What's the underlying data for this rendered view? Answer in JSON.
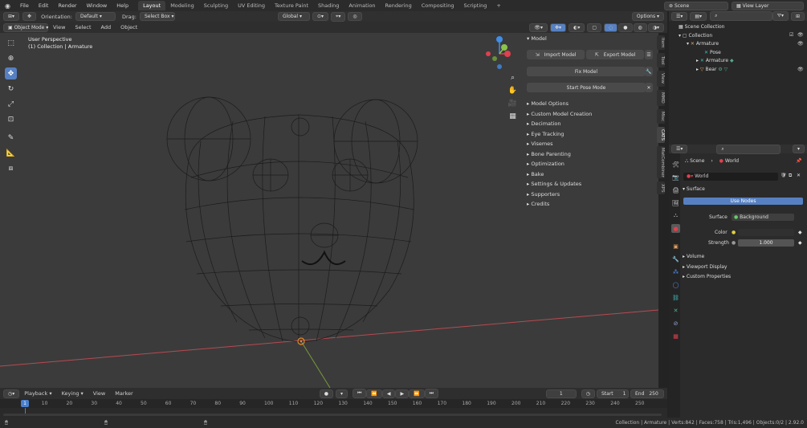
{
  "menubar": {
    "items": [
      "File",
      "Edit",
      "Render",
      "Window",
      "Help"
    ],
    "workspaces": [
      "Layout",
      "Modeling",
      "Sculpting",
      "UV Editing",
      "Texture Paint",
      "Shading",
      "Animation",
      "Rendering",
      "Compositing",
      "Scripting"
    ],
    "active_workspace": "Layout",
    "add_tab": "+",
    "scene_label": "Scene",
    "view_layer_label": "View Layer"
  },
  "toolheader": {
    "orientation_label": "Orientation:",
    "orientation_value": "Default",
    "drag_label": "Drag:",
    "drag_value": "Select Box",
    "transform_value": "Global",
    "options_label": "Options"
  },
  "viewport_header": {
    "mode": "Object Mode",
    "menus": [
      "View",
      "Select",
      "Add",
      "Object"
    ]
  },
  "viewport": {
    "perspective": "User Perspective",
    "collection_info": "(1) Collection | Armature"
  },
  "npanel": {
    "header": "Model",
    "import_label": "Import Model",
    "export_label": "Export Model",
    "fix_label": "Fix Model",
    "pose_label": "Start Pose Mode",
    "sections": [
      "Model Options",
      "Custom Model Creation",
      "Decimation",
      "Eye Tracking",
      "Visemes",
      "Bone Parenting",
      "Optimization",
      "Bake",
      "Settings & Updates",
      "Supporters",
      "Credits"
    ],
    "side_tabs": [
      "Item",
      "Tool",
      "View",
      "MMD",
      "Misc",
      "CATS",
      "MatCombiner",
      "XPS"
    ]
  },
  "outliner": {
    "rows": [
      {
        "label": "Scene Collection",
        "indent": 0
      },
      {
        "label": "Collection",
        "indent": 1
      },
      {
        "label": "Armature",
        "indent": 2
      },
      {
        "label": "Pose",
        "indent": 3
      },
      {
        "label": "Armature",
        "indent": 3
      },
      {
        "label": "Bear",
        "indent": 2
      }
    ]
  },
  "properties": {
    "breadcrumb_scene": "Scene",
    "breadcrumb_world": "World",
    "world_name": "World",
    "surface_header": "Surface",
    "use_nodes_label": "Use Nodes",
    "surface_label": "Surface",
    "surface_value": "Background",
    "color_label": "Color",
    "strength_label": "Strength",
    "strength_value": "1.000",
    "sections": [
      "Volume",
      "Viewport Display",
      "Custom Properties"
    ]
  },
  "timeline": {
    "menus": [
      "Playback",
      "Keying",
      "View",
      "Marker"
    ],
    "current_frame": "1",
    "start_label": "Start",
    "start_value": "1",
    "end_label": "End",
    "end_value": "250",
    "ruler": [
      "0",
      "10",
      "20",
      "30",
      "40",
      "50",
      "60",
      "70",
      "80",
      "90",
      "100",
      "110",
      "120",
      "130",
      "140",
      "150",
      "160",
      "170",
      "180",
      "190",
      "200",
      "210",
      "220",
      "230",
      "240",
      "250"
    ]
  },
  "statusbar": {
    "text": "Collection | Armature | Verts:842 | Faces:758 | Tris:1,496 | Objects:0/2 | 2.92.0"
  },
  "colors": {
    "accent": "#5680c2",
    "axis_x": "#e0404f",
    "axis_y": "#8bc34a",
    "axis_z": "#3f8ee8",
    "background": "#3b3b3b"
  }
}
